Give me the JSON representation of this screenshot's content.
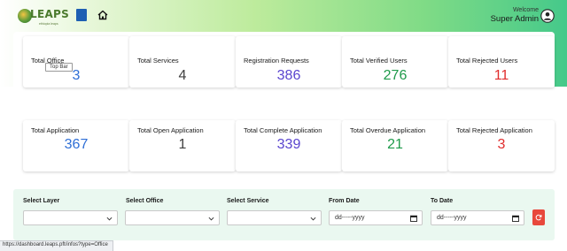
{
  "header": {
    "logo_text": "LEAPS",
    "logo_subtitle": "ethiopia leaps",
    "welcome_label": "Welcome",
    "user_name": "Super Admin"
  },
  "colors": {
    "blue": "#2f6fd6",
    "dark": "#404040",
    "purple": "#5a45cf",
    "green": "#1e9a4a",
    "red": "#e02d2d"
  },
  "stats_row1": [
    {
      "title": "Total Office",
      "value": "3",
      "color": "#2f6fd6"
    },
    {
      "title": "Total Services",
      "value": "4",
      "color": "#404040"
    },
    {
      "title": "Registration Requests",
      "value": "386",
      "color": "#5a45cf"
    },
    {
      "title": "Total Verified Users",
      "value": "276",
      "color": "#1e9a4a"
    },
    {
      "title": "Total Rejected Users",
      "value": "11",
      "color": "#e02d2d"
    }
  ],
  "stats_row2": [
    {
      "title": "Total Application",
      "value": "367",
      "color": "#2f6fd6"
    },
    {
      "title": "Total Open Application",
      "value": "1",
      "color": "#404040"
    },
    {
      "title": "Total Complete Application",
      "value": "339",
      "color": "#5a45cf"
    },
    {
      "title": "Total Overdue Application",
      "value": "21",
      "color": "#1e9a4a"
    },
    {
      "title": "Total Rejected Application",
      "value": "3",
      "color": "#e02d2d"
    }
  ],
  "tooltip_text": "Top Bar",
  "filters": {
    "layer_label": "Select Layer",
    "office_label": "Select Office",
    "service_label": "Select Service",
    "from_label": "From Date",
    "to_label": "To Date",
    "from_placeholder": "dd-----yyyy",
    "to_placeholder": "dd-----yyyy"
  },
  "status_url": "https://dashboard.leaps.pft/infos?type=Office"
}
